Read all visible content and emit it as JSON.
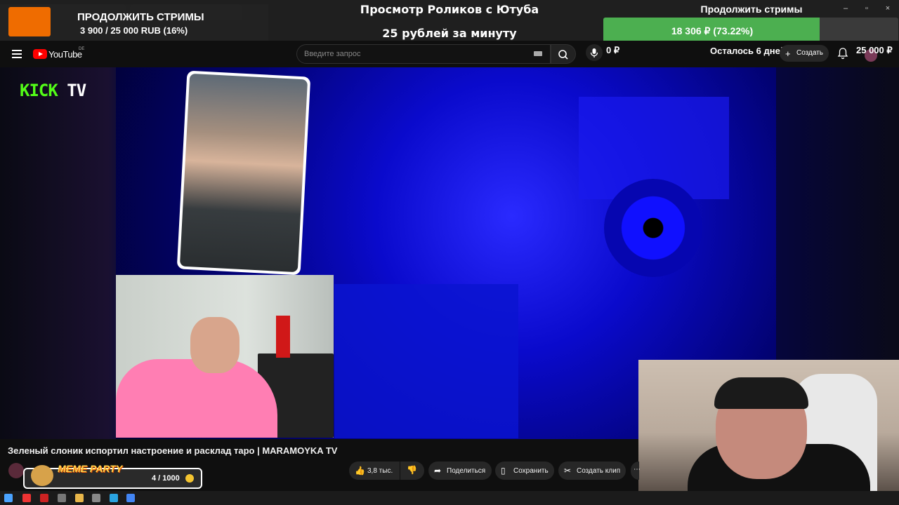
{
  "overlay": {
    "left_title": "ПРОДОЛЖИТЬ СТРИМЫ",
    "left_amount": "3 900 / 25 000 RUB (16%)",
    "center_title": "Просмотр Роликов с Ютуба",
    "center_sub": "25 рублей за минуту",
    "right_title": "Продолжить стримы",
    "right_progress_label": "18 306 ₽ (73.22%)",
    "right_progress_fraction": 0.7322,
    "rub_zero": "0 ₽",
    "days_left": "Осталось 6 дней",
    "goal": "25 000 ₽"
  },
  "youtube": {
    "logo_text": "YouTube",
    "region": "DE",
    "search_placeholder": "Введите запрос",
    "create_label": "Создать"
  },
  "video": {
    "kick_label": "KICK",
    "tv_label": "TV",
    "title": "Зеленый слоник испортил настроение и расклад таро | MARAMOYKA TV"
  },
  "actions": {
    "likes": "3,8 тыс.",
    "share": "Поделиться",
    "save": "Сохранить",
    "clip": "Создать клип"
  },
  "meme_party": {
    "title": "MEME PARTY",
    "count": "4 / 1000"
  },
  "colors": {
    "progress_fill": "#4caf50",
    "youtube_red": "#ff0000",
    "kick_green": "#53fc18"
  }
}
